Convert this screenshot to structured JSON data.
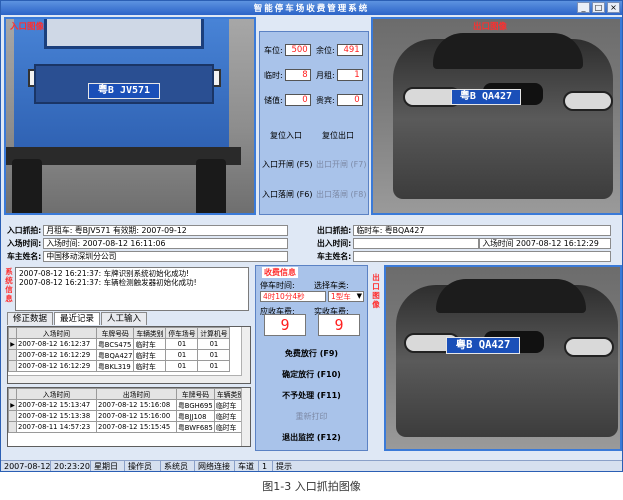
{
  "window": {
    "title": "智能停车场收费管理系统"
  },
  "cameras": {
    "entry_label": "入口图像",
    "exit_label": "出口图像",
    "entry_plate": "粤B JV571",
    "exit_plate": "粤B QA427",
    "exit2_plate": "粤B QA427"
  },
  "stats": {
    "car_count_label": "车位:",
    "car_count": "500",
    "remaining_label": "余位:",
    "remaining": "491",
    "temp_label": "临时:",
    "temp": "8",
    "monthly_label": "月租:",
    "monthly": "1",
    "stored_label": "储值:",
    "stored": "0",
    "vip_label": "贵宾:",
    "vip": "0",
    "reset_entry": "复位入口",
    "reset_exit": "复位出口",
    "entry_open": "入口开闸 (F5)",
    "exit_open": "出口开闸 (F7)",
    "entry_close": "入口落闸 (F6)",
    "exit_close": "出口落闸 (F8)"
  },
  "entry_info": {
    "capture_label": "入口抓拍:",
    "capture_value": "月租车: 粤BJV571 有效期: 2007-09-12",
    "time_label": "入场时间:",
    "time_value": "入场时间: 2007-08-12 16:11:06",
    "owner_label": "车主姓名:",
    "owner_value": "中国移动深圳分公司"
  },
  "exit_info": {
    "capture_label": "出口抓拍:",
    "capture_value": "临时车: 粤BQA427",
    "time_label": "出入时间:",
    "time_value": "入场时间 2007-08-12 16:12:29",
    "owner_label": "车主姓名:",
    "owner_value": ""
  },
  "sidebar_labels": {
    "system_info": "系统信息",
    "charge_info": "收费信息",
    "exit_image2": "出口图像"
  },
  "messages": [
    "2007-08-12 16:21:37: 车牌识别系统初始化成功!",
    "2007-08-12 16:21:37: 车辆检测触发器初始化成功!"
  ],
  "tabs": [
    "修正数据",
    "最近记录",
    "人工输入"
  ],
  "entry_records": {
    "headers": [
      "入场时间",
      "车牌号码",
      "车辆类别",
      "停车场号",
      "计算机号"
    ],
    "rows": [
      [
        "2007-08-12 16:12:37",
        "粤BCS475",
        "临时车",
        "01",
        "01"
      ],
      [
        "2007-08-12 16:12:29",
        "粤BQA427",
        "临时车",
        "01",
        "01"
      ],
      [
        "2007-08-12 16:12:29",
        "粤BKL319",
        "临时车",
        "01",
        "01"
      ]
    ]
  },
  "exit_records": {
    "headers": [
      "入场时间",
      "出场时间",
      "车牌号码",
      "车辆类别"
    ],
    "rows": [
      [
        "2007-08-12 15:13:47",
        "2007-08-12 15:16:08",
        "粤BGH695",
        "临时车"
      ],
      [
        "2007-08-12 15:13:38",
        "2007-08-12 15:16:00",
        "粤BJJ108",
        "临时车"
      ],
      [
        "2007-08-11 14:57:23",
        "2007-08-12 15:15:45",
        "粤BWF685",
        "临时车"
      ]
    ]
  },
  "charge": {
    "title": "收费信息",
    "park_time_label": "停车时间:",
    "car_type_label": "选择车类:",
    "park_time_value": "4时10分4秒",
    "car_type_value": "1型车",
    "due_label": "应收车费:",
    "paid_label": "实收车费:",
    "due_value": "9",
    "paid_value": "9",
    "btn_free": "免费放行 (F9)",
    "btn_confirm": "确定放行 (F10)",
    "btn_ignore": "不予处理 (F11)",
    "btn_reprint": "重新打印",
    "btn_exit_monitor": "退出监控 (F12)"
  },
  "statusbar": [
    "2007-08-12",
    "20:23:20",
    "星期日",
    "操作员",
    "系统员",
    "网络连接",
    "车道",
    "1",
    "提示"
  ],
  "caption": "图1-3 入口抓拍图像"
}
